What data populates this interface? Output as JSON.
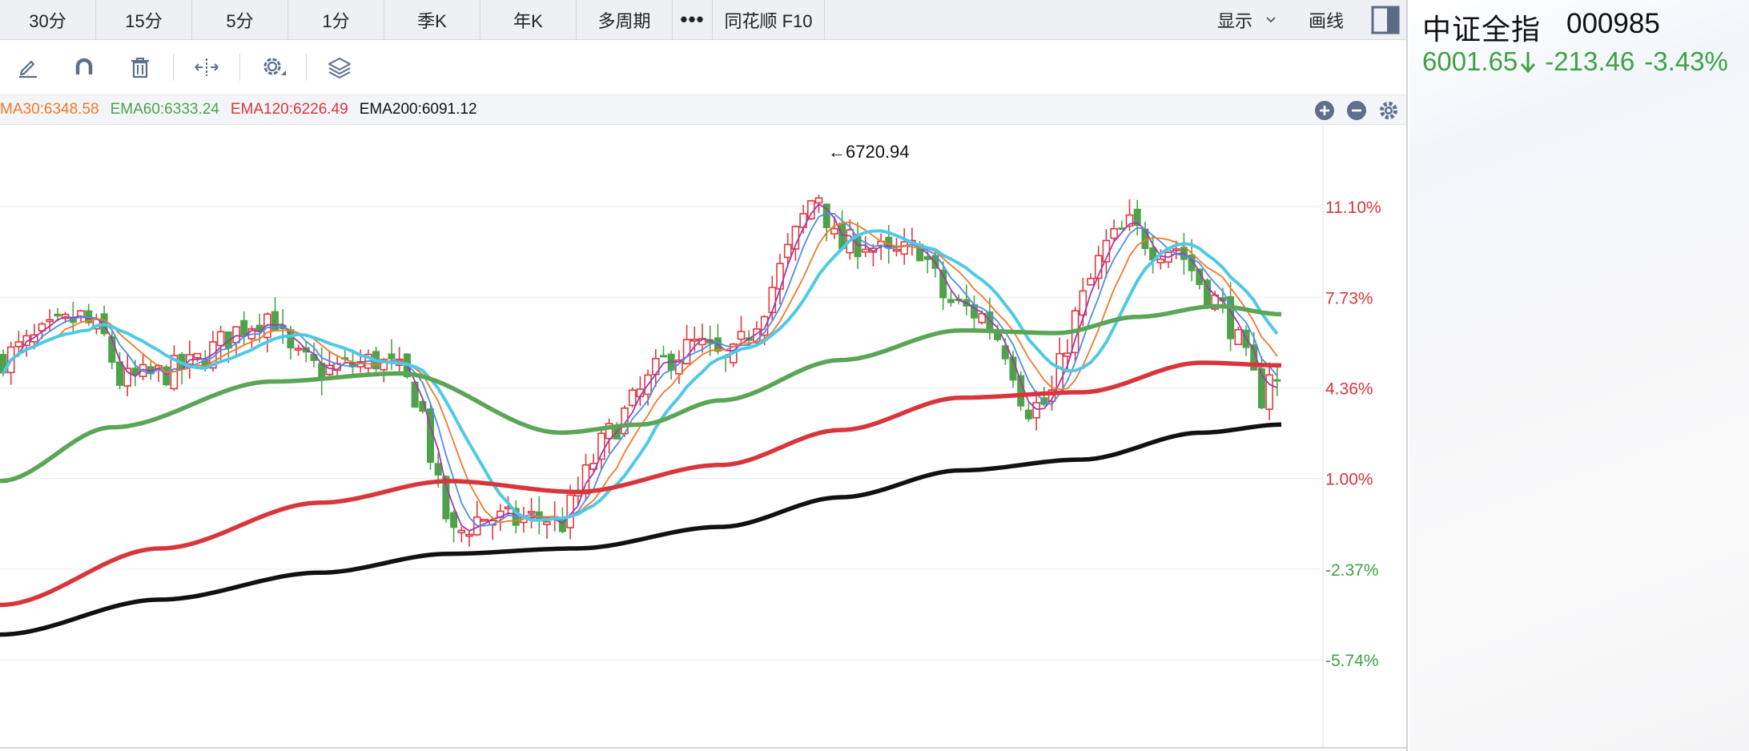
{
  "period_tabs": [
    "30分",
    "15分",
    "5分",
    "1分",
    "季K",
    "年K",
    "多周期",
    "•••",
    "同花顺 F10"
  ],
  "display_label": "显示",
  "draw_label": "画线",
  "ma_legend": [
    {
      "label": "MA30:6348.58",
      "color": "#f07a2a"
    },
    {
      "label": "EMA60:6333.24",
      "color": "#4fa24a"
    },
    {
      "label": "EMA120:6226.49",
      "color": "#d9363b"
    },
    {
      "label": "EMA200:6091.12",
      "color": "#111111"
    }
  ],
  "chart": {
    "high_label": "←6720.94",
    "y_axis_labels": [
      {
        "text": "11.10%",
        "value": 11.1,
        "color": "#d9363b"
      },
      {
        "text": "7.73%",
        "value": 7.73,
        "color": "#d9363b"
      },
      {
        "text": "4.36%",
        "value": 4.36,
        "color": "#d9363b"
      },
      {
        "text": "1.00%",
        "value": 1.0,
        "color": "#d9363b"
      },
      {
        "text": "-2.37%",
        "value": -2.37,
        "color": "#3fa145"
      },
      {
        "text": "-5.74%",
        "value": -5.74,
        "color": "#3fa145"
      }
    ],
    "colors": {
      "up": "#e0383e",
      "down": "#4fa24a",
      "ma_purple": "#a23aa8",
      "ma_blue": "#4d8ee8",
      "ma_orange": "#f07a2a",
      "ma_cyan": "#4fc9e6",
      "ema60": "#5aa656",
      "ema120": "#d9363b",
      "ema200": "#111111"
    }
  },
  "quote": {
    "name": "中证全指",
    "code": "000985",
    "price": "6001.65",
    "change": "-213.46",
    "change_pct": "-3.43%",
    "color": "#3fa145"
  }
}
